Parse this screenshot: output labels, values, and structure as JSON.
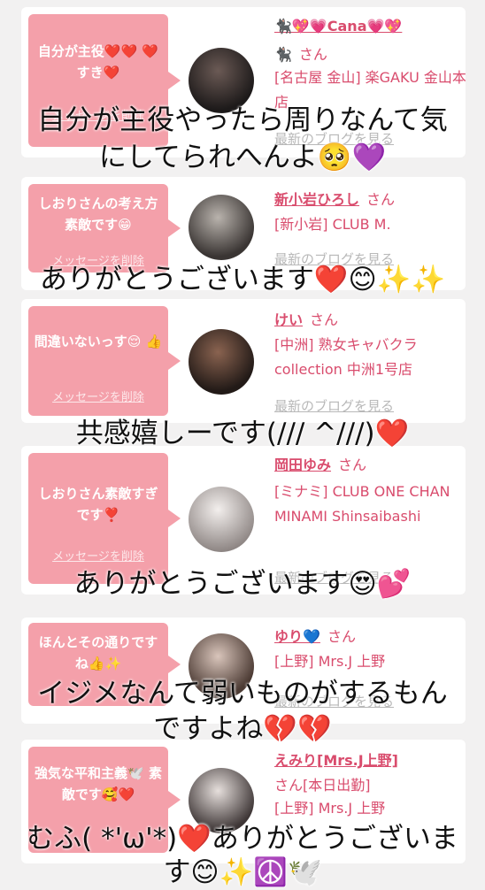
{
  "cards": [
    {
      "bubble": "自分が主役❤️❤️ ❤️すき❤️",
      "delete": "メッセージを削除",
      "name": "🐈‍⬛💖💗Cana💗💖",
      "san": "さん",
      "shop": "[名古屋 金山] 楽GAKU 金山本店",
      "blog": "最新のブログを見る"
    },
    {
      "bubble": "しおりさんの考え方素敵です😁",
      "delete": "メッセージを削除",
      "name": "新小岩ひろし",
      "san": "さん",
      "shop": "[新小岩] CLUB M.",
      "blog": "最新のブログを見る"
    },
    {
      "bubble": "間違いないっす😌 👍",
      "delete": "メッセージを削除",
      "name": "けい",
      "san": "さん",
      "shop": "[中洲] 熟女キャバクラ collection 中洲1号店",
      "blog": "最新のブログを見る"
    },
    {
      "bubble": "しおりさん素敵すぎです❣️",
      "delete": "メッセージを削除",
      "name": "岡田ゆみ",
      "san": "さん",
      "shop": "[ミナミ] CLUB ONE CHAN MINAMI Shinsaibashi",
      "blog": "最新のブログを見る"
    },
    {
      "bubble": "ほんとその通りですね👍✨",
      "delete": "メッセージを削除",
      "name": "ゆり💙",
      "san": "さん",
      "shop": "[上野] Mrs.J 上野",
      "blog": "最新のブログを見る"
    },
    {
      "bubble": "強気な平和主義🕊️ 素敵です🥰❤️",
      "delete": "メッセージを削除",
      "name": "えみり[Mrs.J上野]",
      "san": "さん[本日出勤]",
      "shop": "[上野] Mrs.J 上野",
      "blog": "最新のブログを見る"
    }
  ],
  "captions": [
    "自分が主役やったら周りなんて気",
    "にしてられへんよ🥺💜",
    "ありがとうございます❤️😊✨✨",
    "共感嬉しーです(/// ^///)❤️",
    "ありがとうございます😍💕",
    "イジメなんて弱いものがするもん",
    "ですよね💔💔",
    "むふ( *'ω'*)❤️ありがとうございま",
    "す😊✨☮️🕊️"
  ]
}
